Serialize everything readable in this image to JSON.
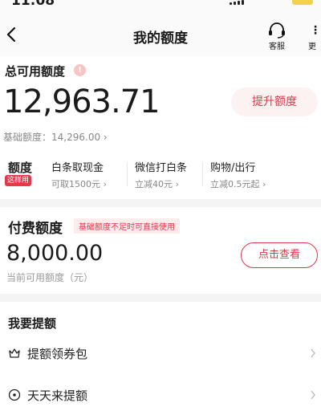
{
  "status_bar": {
    "time": "11:08"
  },
  "nav": {
    "title": "我的额度",
    "customer_service_label": "客服",
    "more_label": "更"
  },
  "total": {
    "label": "总可用额度",
    "amount": "12,963.71",
    "raise_button": "提升额度",
    "base_label": "基础额度：",
    "base_value": "14,296.00"
  },
  "quota": {
    "title": "额度",
    "badge": "这样用",
    "items": [
      {
        "title": "白条取现金",
        "sub": "可取1500元"
      },
      {
        "title": "微信打白条",
        "sub": "立减40元"
      },
      {
        "title": "购物/出行",
        "sub": "立减0.5元起"
      }
    ]
  },
  "paid": {
    "title": "付费额度",
    "tag": "基础额度不足时可直接使用",
    "amount": "8,000.00",
    "sub": "当前可用额度（元）",
    "view_button": "点击查看"
  },
  "raise_section": {
    "title": "我要提额",
    "items": [
      {
        "label": "提额领券包",
        "icon": "crown-icon"
      },
      {
        "label": "天天来提额",
        "icon": "target-icon"
      }
    ]
  },
  "colors": {
    "accent": "#e0364b",
    "badge": "#e5394a",
    "muted": "#888888"
  }
}
